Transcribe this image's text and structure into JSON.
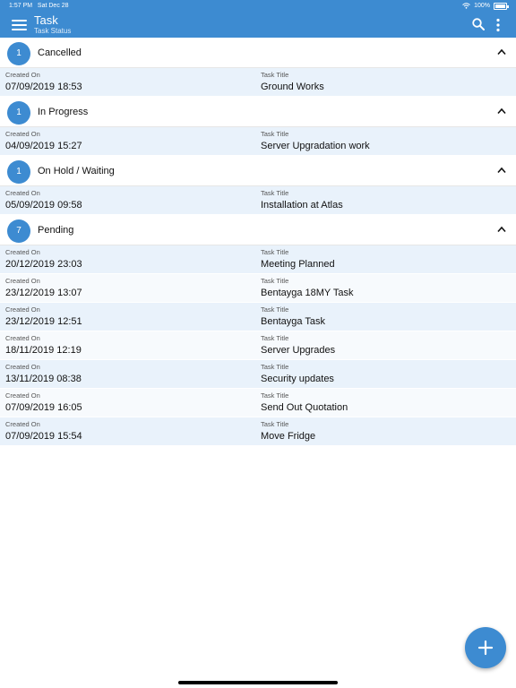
{
  "status": {
    "time": "1:57 PM",
    "date": "Sat Dec 28",
    "battery": "100%"
  },
  "header": {
    "title": "Task",
    "subtitle": "Task Status"
  },
  "labels": {
    "created": "Created On",
    "task": "Task Title"
  },
  "groups": [
    {
      "count": "1",
      "label": "Cancelled",
      "rows": [
        {
          "created": "07/09/2019 18:53",
          "title": "Ground Works"
        }
      ]
    },
    {
      "count": "1",
      "label": "In Progress",
      "rows": [
        {
          "created": "04/09/2019 15:27",
          "title": "Server Upgradation work"
        }
      ]
    },
    {
      "count": "1",
      "label": "On Hold / Waiting",
      "rows": [
        {
          "created": "05/09/2019 09:58",
          "title": "Installation at Atlas"
        }
      ]
    },
    {
      "count": "7",
      "label": "Pending",
      "rows": [
        {
          "created": "20/12/2019 23:03",
          "title": "Meeting Planned"
        },
        {
          "created": "23/12/2019 13:07",
          "title": "Bentayga 18MY Task"
        },
        {
          "created": "23/12/2019 12:51",
          "title": "Bentayga Task"
        },
        {
          "created": "18/11/2019 12:19",
          "title": "Server Upgrades"
        },
        {
          "created": "13/11/2019 08:38",
          "title": "Security updates"
        },
        {
          "created": "07/09/2019 16:05",
          "title": "Send Out Quotation"
        },
        {
          "created": "07/09/2019 15:54",
          "title": "Move Fridge"
        }
      ]
    }
  ],
  "colors": {
    "accent": "#3d8bd1",
    "row": "#e9f2fb",
    "row_alt": "#f7fafd"
  },
  "icons": [
    "menu-icon",
    "search-icon",
    "more-vertical-icon",
    "chevron-up-icon",
    "plus-icon",
    "wifi-icon",
    "battery-icon"
  ]
}
